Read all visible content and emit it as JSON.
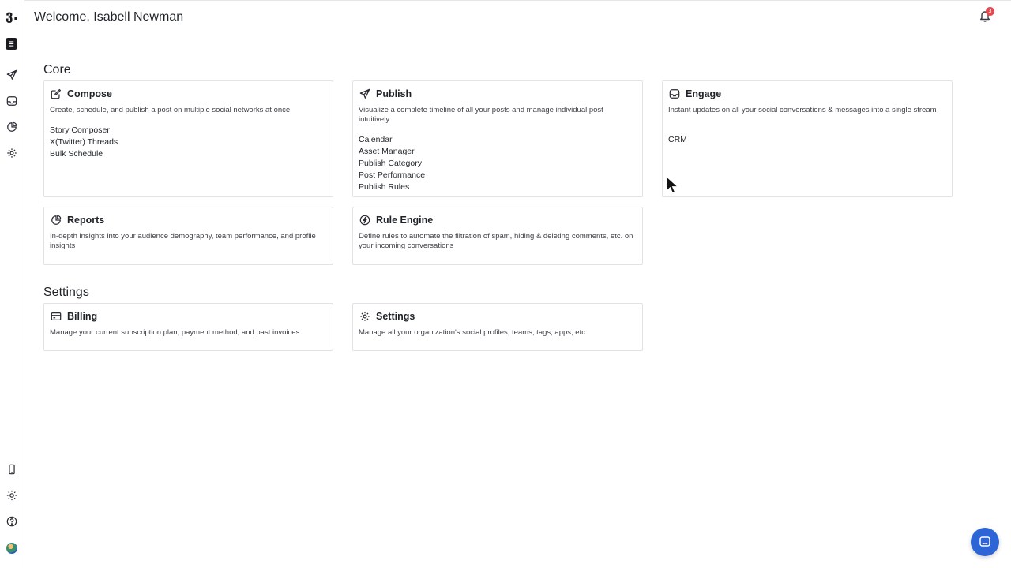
{
  "header": {
    "welcome": "Welcome, Isabell Newman",
    "notification_count": "3"
  },
  "sidebar": {
    "logo": "ვ.",
    "icons": [
      "dashboard-icon",
      "send-icon",
      "inbox-icon",
      "chart-pie-icon",
      "gear-icon"
    ],
    "bottom_icons": [
      "mobile-icon",
      "sun-icon",
      "help-icon",
      "avatar"
    ]
  },
  "sections": {
    "core": "Core",
    "settings": "Settings"
  },
  "cards": {
    "compose": {
      "title": "Compose",
      "description": "Create, schedule, and publish a post on multiple social networks at once",
      "links": [
        "Story Composer",
        "X(Twitter) Threads",
        "Bulk Schedule"
      ]
    },
    "publish": {
      "title": "Publish",
      "description": "Visualize a complete timeline of all your posts and manage individual post intuitively",
      "links": [
        "Calendar",
        "Asset Manager",
        "Publish Category",
        "Post Performance",
        "Publish Rules"
      ]
    },
    "engage": {
      "title": "Engage",
      "description": "Instant updates on all your social conversations & messages into a single stream",
      "links": [
        "CRM"
      ]
    },
    "reports": {
      "title": "Reports",
      "description": "In-depth insights into your audience demography, team performance, and profile insights"
    },
    "rule_engine": {
      "title": "Rule Engine",
      "description": "Define rules to automate the filtration of spam, hiding & deleting comments, etc. on your incoming conversations"
    },
    "billing": {
      "title": "Billing",
      "description": "Manage your current subscription plan, payment method, and past invoices"
    },
    "settings": {
      "title": "Settings",
      "description": "Manage all your organization's social profiles, teams, tags, apps, etc"
    }
  },
  "colors": {
    "accent": "#2d64d6",
    "badge": "#e5484d",
    "text": "#1f2328",
    "border": "#e2e2e6"
  }
}
